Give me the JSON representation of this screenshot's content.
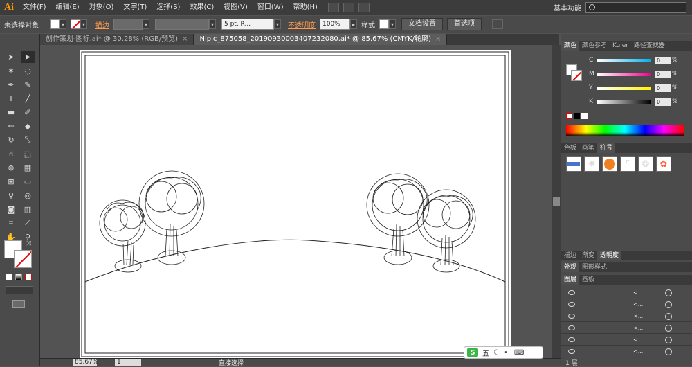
{
  "app": {
    "logo": "Ai"
  },
  "menu": [
    "文件(F)",
    "编辑(E)",
    "对象(O)",
    "文字(T)",
    "选择(S)",
    "效果(C)",
    "视图(V)",
    "窗口(W)",
    "帮助(H)"
  ],
  "workspace": "基本功能",
  "control": {
    "selection_label": "未选择对象",
    "stroke_label": "描边",
    "brush_value": "5 pt. R...",
    "opacity_label": "不透明度",
    "opacity_value": "100%",
    "style_label": "样式",
    "doc_setup": "文档设置",
    "preferences": "首选项"
  },
  "tabs": [
    {
      "label": "创作策划-图标.ai* @ 30.28% (RGB/预览)"
    },
    {
      "label": "Nipic_875058_20190930003407232080.ai* @ 85.67% (CMYK/轮廓)"
    }
  ],
  "color_panel": {
    "tabs": [
      "颜色",
      "颜色参考",
      "Kuler",
      "路径查找器"
    ],
    "channels": [
      {
        "name": "C",
        "value": "0",
        "color": "#00aeef"
      },
      {
        "name": "M",
        "value": "0",
        "color": "#ec008c"
      },
      {
        "name": "Y",
        "value": "0",
        "color": "#fff200"
      },
      {
        "name": "K",
        "value": "0",
        "color": "#000000"
      }
    ],
    "percent": "%"
  },
  "symbol_panel": {
    "tabs": [
      "色板",
      "画笔",
      "符号"
    ]
  },
  "transparency_panel": {
    "tabs": [
      "描边",
      "渐变",
      "透明度"
    ]
  },
  "appearance_panel": {
    "tabs": [
      "外观",
      "图形样式"
    ]
  },
  "layers_panel": {
    "tabs": [
      "图层",
      "画板"
    ],
    "footer": "1 层",
    "row_labels": [
      "<...",
      "<...",
      "<...",
      "<...",
      "<...",
      "<..."
    ]
  },
  "status": {
    "zoom": "85.67%",
    "page": "1",
    "mode": "直接选择"
  },
  "ime": {
    "logo": "S",
    "label": "五"
  }
}
